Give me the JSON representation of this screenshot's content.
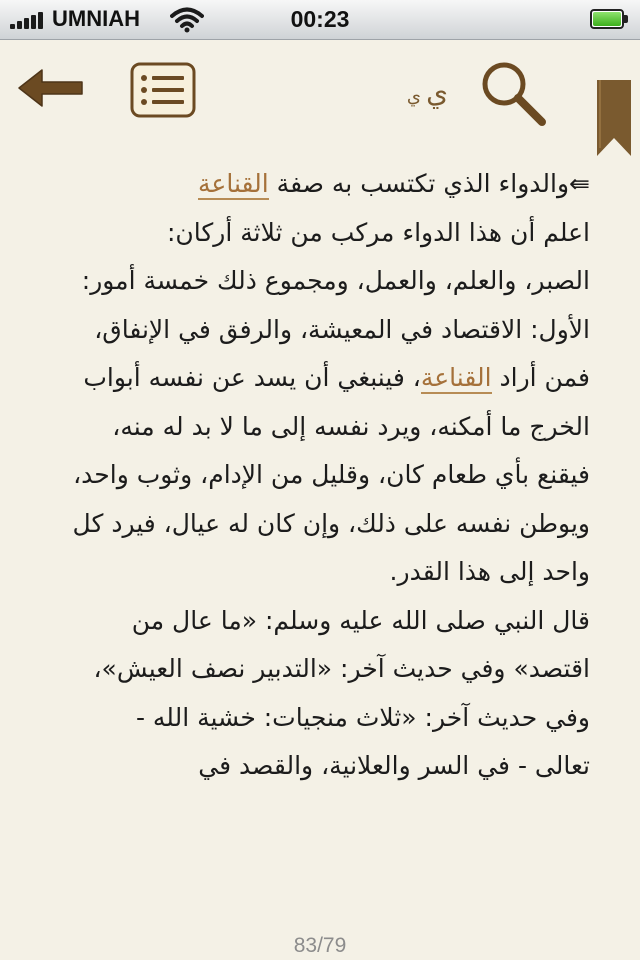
{
  "status_bar": {
    "carrier": "UMNIAH",
    "time": "00:23"
  },
  "toolbar": {
    "font_size_large": "ي",
    "font_size_small": "ي"
  },
  "content": {
    "lines": [
      {
        "before": "⇚والدواء الذي تكتسب به صفة ",
        "highlight": "القناعة",
        "after": ""
      },
      {
        "before": "اعلم أن هذا الدواء مركب من ثلاثة أركان:",
        "highlight": "",
        "after": ""
      },
      {
        "before": "الصبر، والعلم، والعمل، ومجموع ذلك خمسة أمور:",
        "highlight": "",
        "after": ""
      },
      {
        "before": "الأول: الاقتصاد في المعيشة، والرفق في الإنفاق،",
        "highlight": "",
        "after": ""
      },
      {
        "before": "فمن أراد ",
        "highlight": "القناعة",
        "after": "، فينبغي أن يسد عن نفسه أبواب"
      },
      {
        "before": "الخرج ما أمكنه، ويرد نفسه إلى ما لا بد له منه،",
        "highlight": "",
        "after": ""
      },
      {
        "before": "فيقنع بأي طعام كان، وقليل من الإدام، وثوب واحد،",
        "highlight": "",
        "after": ""
      },
      {
        "before": "ويوطن نفسه على ذلك، وإن كان له عيال، فيرد كل",
        "highlight": "",
        "after": ""
      },
      {
        "before": "واحد إلى هذا القدر.",
        "highlight": "",
        "after": ""
      },
      {
        "before": "قال النبي صلى الله عليه وسلم: «ما عال من",
        "highlight": "",
        "after": ""
      },
      {
        "before": "اقتصد» وفي حديث آخر: «التدبير نصف العيش»،",
        "highlight": "",
        "after": ""
      },
      {
        "before": "وفي حديث آخر: «ثلاث منجيات: خشية الله -",
        "highlight": "",
        "after": ""
      },
      {
        "before": "تعالى - في السر والعلانية، والقصد في",
        "highlight": "",
        "after": ""
      }
    ]
  },
  "footer": {
    "page_indicator": "83/79"
  },
  "colors": {
    "accent_brown": "#7a5a2f",
    "highlight": "#a5713a",
    "paper": "#f4f1e6"
  },
  "icons": [
    "signal-bars-icon",
    "wifi-icon",
    "battery-icon",
    "back-arrow-icon",
    "list-icon",
    "search-icon",
    "bookmark-ribbon-icon"
  ]
}
